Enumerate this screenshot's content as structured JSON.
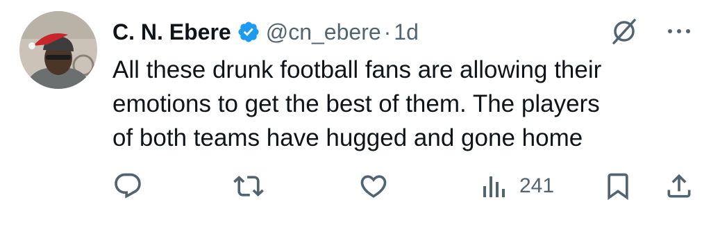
{
  "tweet": {
    "display_name": "C. N. Ebere",
    "handle": "@cn_ebere",
    "separator": "·",
    "time": "1d",
    "verified": true,
    "body_lines": [
      "All these drunk football fans are allowing their",
      "emotions to get the best of them. The players",
      "of both teams have hugged and gone home"
    ],
    "views": "241"
  },
  "icons": {
    "verified": "verified-badge-icon",
    "grok": "grok-icon",
    "more": "more-icon",
    "reply": "reply-icon",
    "retweet": "retweet-icon",
    "like": "like-icon",
    "views": "views-icon",
    "bookmark": "bookmark-icon",
    "share": "share-icon"
  },
  "colors": {
    "text": "#0f1419",
    "secondary": "#536471",
    "verified": "#1d9bf0"
  }
}
